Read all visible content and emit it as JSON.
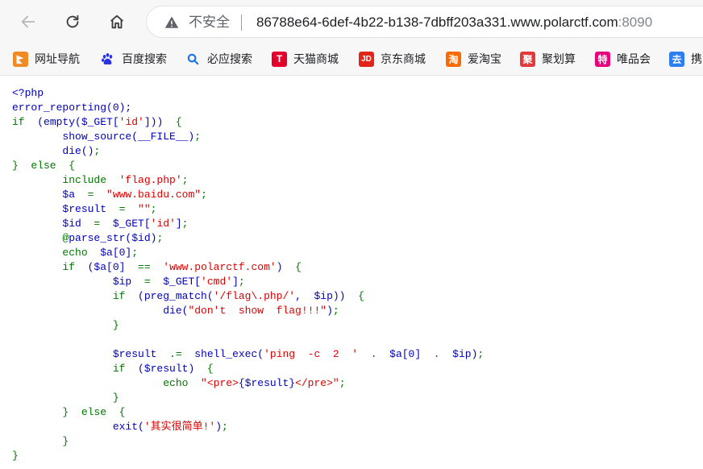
{
  "browser": {
    "insecure_label": "不安全",
    "url_host": "86788e64-6def-4b22-b138-7dbff203a331.www.polarctf.com",
    "url_port": ":8090",
    "icons": {
      "back": "arrow-left-icon",
      "reload": "reload-icon",
      "home": "home-icon",
      "security": "warning-triangle-icon"
    }
  },
  "bookmarks": [
    {
      "label": "网址导航",
      "icon": "hao123-icon",
      "glyph": "",
      "color": "#e87722"
    },
    {
      "label": "百度搜索",
      "icon": "baidu-paw-icon",
      "glyph": "",
      "color": "#2932e1"
    },
    {
      "label": "必应搜索",
      "icon": "search-icon",
      "glyph": "",
      "color": "#1a73e8"
    },
    {
      "label": "天猫商城",
      "icon": "tmall-icon",
      "glyph": "T",
      "color": "#e4002b"
    },
    {
      "label": "京东商城",
      "icon": "jd-icon",
      "glyph": "JD",
      "color": "#e1251b"
    },
    {
      "label": "爱淘宝",
      "icon": "taobao-icon",
      "glyph": "淘",
      "color": "#ff6a00"
    },
    {
      "label": "聚划算",
      "icon": "juhuasuan-icon",
      "glyph": "聚",
      "color": "#e4393c"
    },
    {
      "label": "唯品会",
      "icon": "vip-icon",
      "glyph": "特",
      "color": "#e6007e"
    },
    {
      "label": "携",
      "icon": "ctrip-icon",
      "glyph": "去",
      "color": "#2c7ff0"
    }
  ],
  "code_lines": [
    [
      [
        "k",
        "<?php"
      ]
    ],
    [
      [
        "k",
        "error_reporting(0);"
      ]
    ],
    [
      [
        "kw",
        "if  "
      ],
      [
        "k",
        "(empty($_GET["
      ],
      [
        "s",
        "'id'"
      ],
      [
        "k",
        "]))  "
      ],
      [
        "kw",
        "{"
      ]
    ],
    [
      [
        "k",
        "        show_source(__FILE__)"
      ],
      [
        "kw",
        ";"
      ]
    ],
    [
      [
        "k",
        "        die()"
      ],
      [
        "kw",
        ";"
      ]
    ],
    [
      [
        "kw",
        "}  else  {"
      ]
    ],
    [
      [
        "kw",
        "        include  "
      ],
      [
        "s",
        "'flag.php'"
      ],
      [
        "kw",
        ";"
      ]
    ],
    [
      [
        "k",
        "        $a  "
      ],
      [
        "kw",
        "=  "
      ],
      [
        "s",
        "\"www.baidu.com\""
      ],
      [
        "kw",
        ";"
      ]
    ],
    [
      [
        "k",
        "        $result  "
      ],
      [
        "kw",
        "=  "
      ],
      [
        "s",
        "\"\""
      ],
      [
        "kw",
        ";"
      ]
    ],
    [
      [
        "k",
        "        $id  "
      ],
      [
        "kw",
        "=  "
      ],
      [
        "k",
        "$_GET["
      ],
      [
        "s",
        "'id'"
      ],
      [
        "k",
        "]"
      ],
      [
        "kw",
        ";"
      ]
    ],
    [
      [
        "kw",
        "        @"
      ],
      [
        "k",
        "parse_str($id)"
      ],
      [
        "kw",
        ";"
      ]
    ],
    [
      [
        "kw",
        "        echo  "
      ],
      [
        "k",
        "$a[0]"
      ],
      [
        "kw",
        ";"
      ]
    ],
    [
      [
        "kw",
        "        if  "
      ],
      [
        "k",
        "($a[0]  "
      ],
      [
        "kw",
        "==  "
      ],
      [
        "s",
        "'www.polarctf.com'"
      ],
      [
        "k",
        ")  "
      ],
      [
        "kw",
        "{"
      ]
    ],
    [
      [
        "k",
        "                $ip  "
      ],
      [
        "kw",
        "=  "
      ],
      [
        "k",
        "$_GET["
      ],
      [
        "s",
        "'cmd'"
      ],
      [
        "k",
        "]"
      ],
      [
        "kw",
        ";"
      ]
    ],
    [
      [
        "kw",
        "                if  "
      ],
      [
        "k",
        "(preg_match("
      ],
      [
        "s",
        "'/flag\\.php/'"
      ],
      [
        "k",
        ",  $ip))  "
      ],
      [
        "kw",
        "{"
      ]
    ],
    [
      [
        "k",
        "                        die("
      ],
      [
        "s",
        "\"don't  show  flag!!!\""
      ],
      [
        "k",
        ")"
      ],
      [
        "kw",
        ";"
      ]
    ],
    [
      [
        "kw",
        "                }"
      ]
    ],
    [
      [
        "k",
        ""
      ]
    ],
    [
      [
        "k",
        "                $result  "
      ],
      [
        "kw",
        ".=  "
      ],
      [
        "k",
        "shell_exec("
      ],
      [
        "s",
        "'ping  -c  2  '"
      ],
      [
        "kw",
        "  .  "
      ],
      [
        "k",
        "$a[0]"
      ],
      [
        "kw",
        "  .  "
      ],
      [
        "k",
        "$ip)"
      ],
      [
        "kw",
        ";"
      ]
    ],
    [
      [
        "kw",
        "                if  "
      ],
      [
        "k",
        "($result)  "
      ],
      [
        "kw",
        "{"
      ]
    ],
    [
      [
        "kw",
        "                        echo  "
      ],
      [
        "s",
        "\"<pre>"
      ],
      [
        "k",
        "{$result}"
      ],
      [
        "s",
        "</pre>\""
      ],
      [
        "kw",
        ";"
      ]
    ],
    [
      [
        "kw",
        "                }"
      ]
    ],
    [
      [
        "kw",
        "        }  else  {"
      ]
    ],
    [
      [
        "k",
        "                exit("
      ],
      [
        "s",
        "'其实很简单!'"
      ],
      [
        "k",
        ")"
      ],
      [
        "kw",
        ";"
      ]
    ],
    [
      [
        "kw",
        "        }"
      ]
    ],
    [
      [
        "kw",
        "}"
      ]
    ]
  ]
}
